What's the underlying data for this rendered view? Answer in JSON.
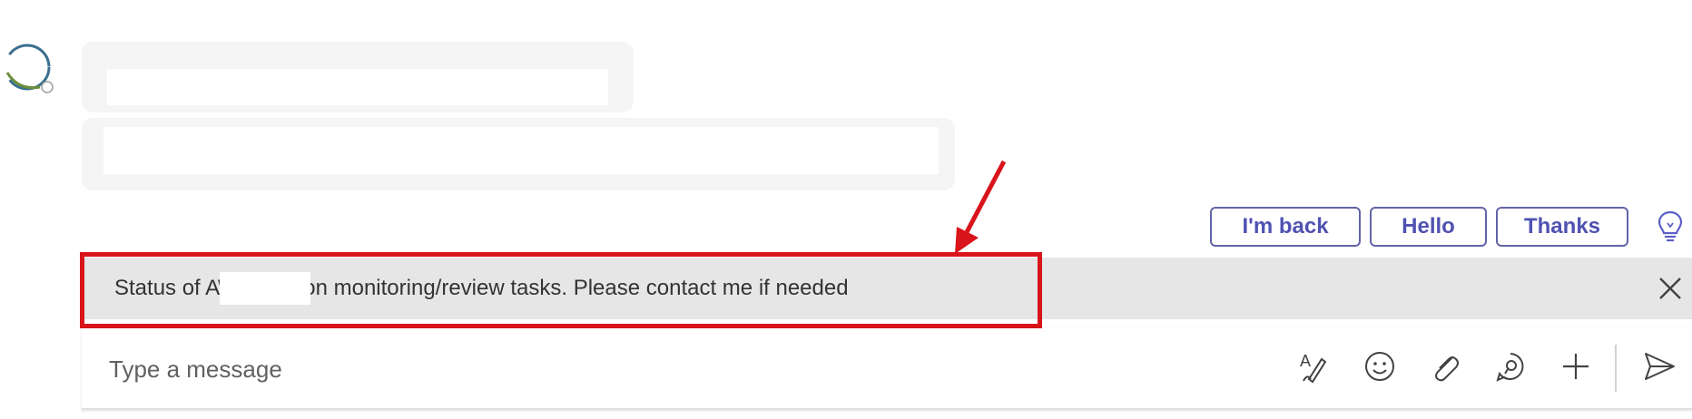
{
  "suggested_replies": [
    "I'm back",
    "Hello",
    "Thanks"
  ],
  "status_banner": {
    "prefix": "Status of A",
    "message": "Working on monitoring/review tasks. Please contact me if needed"
  },
  "compose": {
    "placeholder": "Type a message"
  },
  "icons": {
    "avatar": "avatar",
    "lightbulb": "lightbulb-icon",
    "close": "close-icon",
    "format": "format-icon",
    "emoji": "emoji-icon",
    "attach": "attach-icon",
    "loop": "loop-icon",
    "plus": "plus-icon",
    "send": "send-icon"
  },
  "colors": {
    "accent": "#6264a7",
    "annotation": "#d9141b",
    "banner_bg": "#e6e6e6",
    "bubble_bg": "#f5f5f5"
  }
}
